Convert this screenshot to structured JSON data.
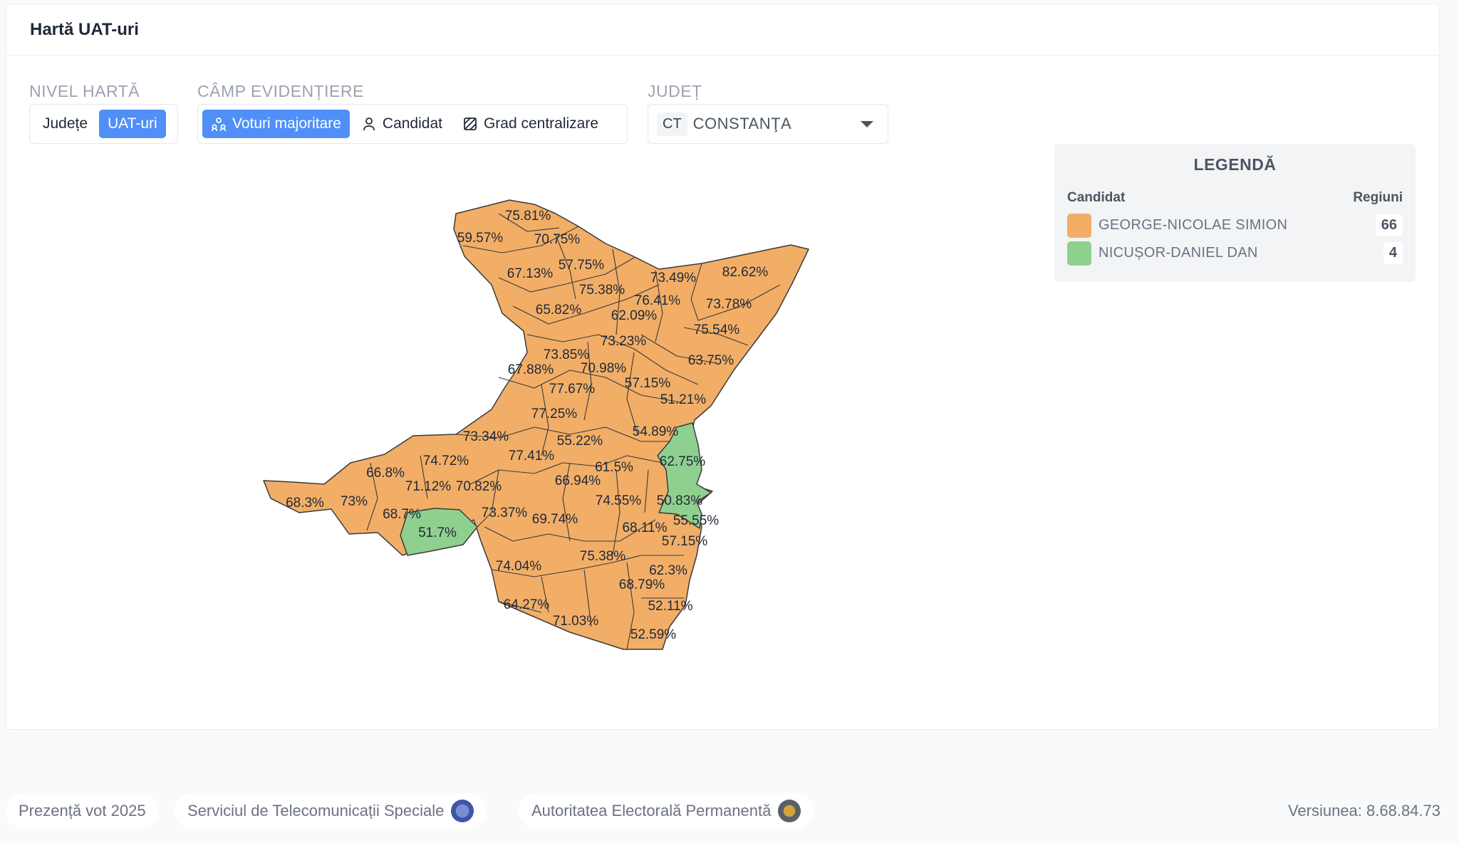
{
  "card": {
    "title": "Hartă UAT-uri"
  },
  "map_level": {
    "label": "NIVEL HARTĂ",
    "options": [
      "Județe",
      "UAT-uri"
    ],
    "selected": "UAT-uri"
  },
  "highlight_field": {
    "label": "CÂMP EVIDENȚIERE",
    "options": [
      "Voturi majoritare",
      "Candidat",
      "Grad centralizare"
    ],
    "selected": "Voturi majoritare"
  },
  "county": {
    "label": "JUDEȚ",
    "code": "CT",
    "name": "CONSTANŢA"
  },
  "legend": {
    "title": "LEGENDĂ",
    "col_candidate": "Candidat",
    "col_regions": "Regiuni",
    "items": [
      {
        "name": "GEORGE-NICOLAE SIMION",
        "count": "66",
        "color": "#f2ae67"
      },
      {
        "name": "NICUȘOR-DANIEL DAN",
        "count": "4",
        "color": "#8fd08f"
      }
    ]
  },
  "map": {
    "colors": {
      "simion": "#f2ae67",
      "dan": "#8fd08f",
      "border": "#3a3a3a"
    },
    "labels": [
      "75.81%",
      "59.57%",
      "70.75%",
      "67.13%",
      "57.75%",
      "73.49%",
      "82.62%",
      "75.38%",
      "76.41%",
      "65.82%",
      "62.09%",
      "73.78%",
      "73.23%",
      "75.54%",
      "73.85%",
      "63.75%",
      "67.88%",
      "70.98%",
      "77.67%",
      "57.15%",
      "51.21%",
      "77.25%",
      "54.89%",
      "73.34%",
      "55.22%",
      "77.41%",
      "74.72%",
      "62.75%",
      "66.8%",
      "61.5%",
      "71.12%",
      "70.82%",
      "66.94%",
      "68.3%",
      "73%",
      "74.55%",
      "50.83%",
      "68.7%",
      "73.37%",
      "69.74%",
      "55.55%",
      "51.7%",
      "68.11%",
      "57.15%",
      "75.38%",
      "74.04%",
      "62.3%",
      "68.79%",
      "64.27%",
      "52.11%",
      "71.03%",
      "52.59%"
    ]
  },
  "footer": {
    "items": [
      "Prezență vot 2025",
      "Serviciul de Telecomunicații Speciale",
      "Autoritatea Electorală Permanentă"
    ],
    "version": "Versiunea: 8.68.84.73"
  }
}
